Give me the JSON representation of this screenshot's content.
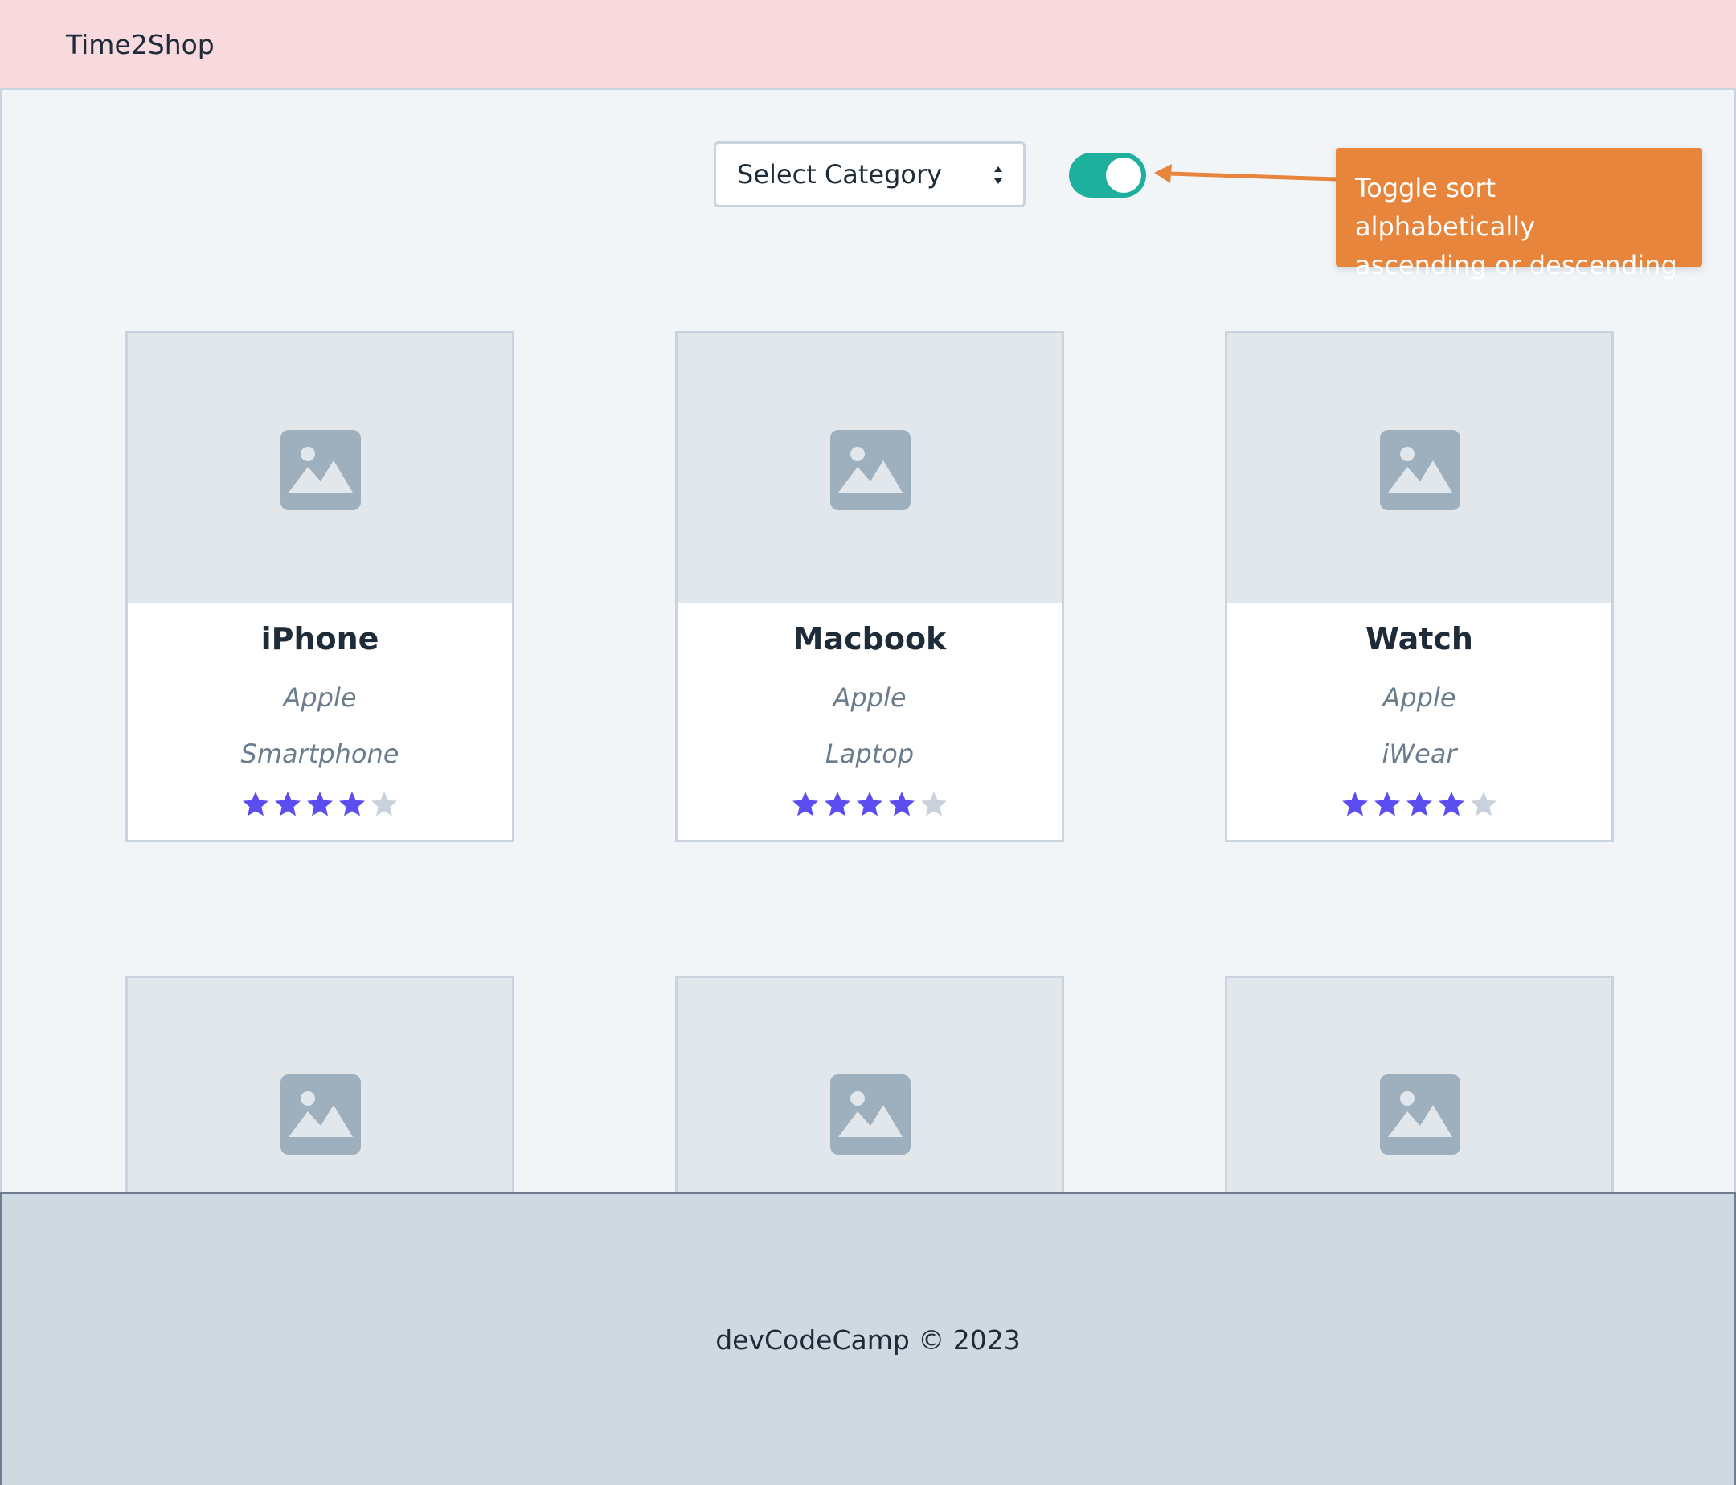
{
  "navbar": {
    "brand": "Time2Shop"
  },
  "controls": {
    "select_category": "Select Category",
    "sort_toggle_on": true
  },
  "annotation": {
    "line1": "Toggle sort alphabetically",
    "line2": "ascending or descending"
  },
  "products": [
    {
      "name": "iPhone",
      "brand": "Apple",
      "category": "Smartphone",
      "rating": 4,
      "max_rating": 5
    },
    {
      "name": "Macbook",
      "brand": "Apple",
      "category": "Laptop",
      "rating": 4,
      "max_rating": 5
    },
    {
      "name": "Watch",
      "brand": "Apple",
      "category": "iWear",
      "rating": 4,
      "max_rating": 5
    }
  ],
  "footer": {
    "copyright": "devCodeCamp © 2023"
  },
  "colors": {
    "navbar_bg": "#f8d9de",
    "toggle_on": "#1fb09d",
    "annotation_bg": "#e8853c",
    "star_filled": "#5b4df0",
    "star_empty": "#c9d2dc"
  },
  "icons": {
    "product_image": "image-placeholder-icon",
    "rating_star": "star-icon",
    "select_caret": "updown-caret-icon"
  }
}
